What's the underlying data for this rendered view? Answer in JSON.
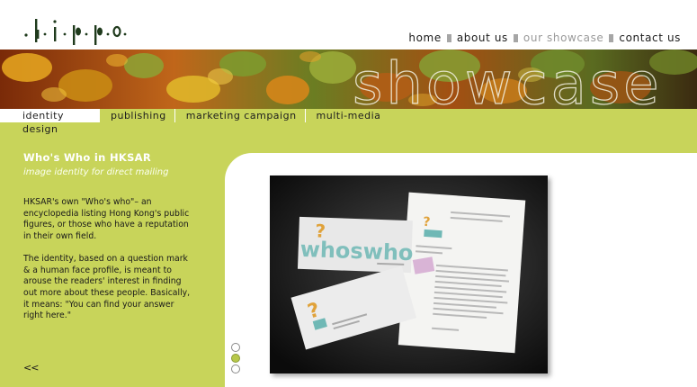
{
  "brand": {
    "logo_text": "hippo"
  },
  "nav": {
    "items": [
      {
        "label": "home",
        "active": false
      },
      {
        "label": "about us",
        "active": false
      },
      {
        "label": "our showcase",
        "active": true
      },
      {
        "label": "contact us",
        "active": false
      }
    ]
  },
  "banner": {
    "word": "showcase"
  },
  "tabs": [
    {
      "label": "identity design",
      "active": true
    },
    {
      "label": "publishing",
      "active": false
    },
    {
      "label": "marketing campaign",
      "active": false
    },
    {
      "label": "multi-media",
      "active": false
    }
  ],
  "project": {
    "title": "Who's Who in HKSAR",
    "subtitle": "image identity for direct mailing",
    "paragraphs": [
      "HKSAR's own \"Who's who\"– an encyclopedia listing Hong Kong's public figures, or those who have a reputation in their own field.",
      "The identity, based on a question mark & a human face profile, is meant to arouse the readers' interest in finding out more about these people. Basically, it means: \"You can find your answer right here.\""
    ],
    "back_label": "<<",
    "artwork_word": "whoswho"
  },
  "pager": {
    "count": 3,
    "active_index": 1
  },
  "colors": {
    "green": "#c8d45a",
    "accent_teal": "#6fb8b5",
    "accent_orange": "#e0a23a"
  }
}
